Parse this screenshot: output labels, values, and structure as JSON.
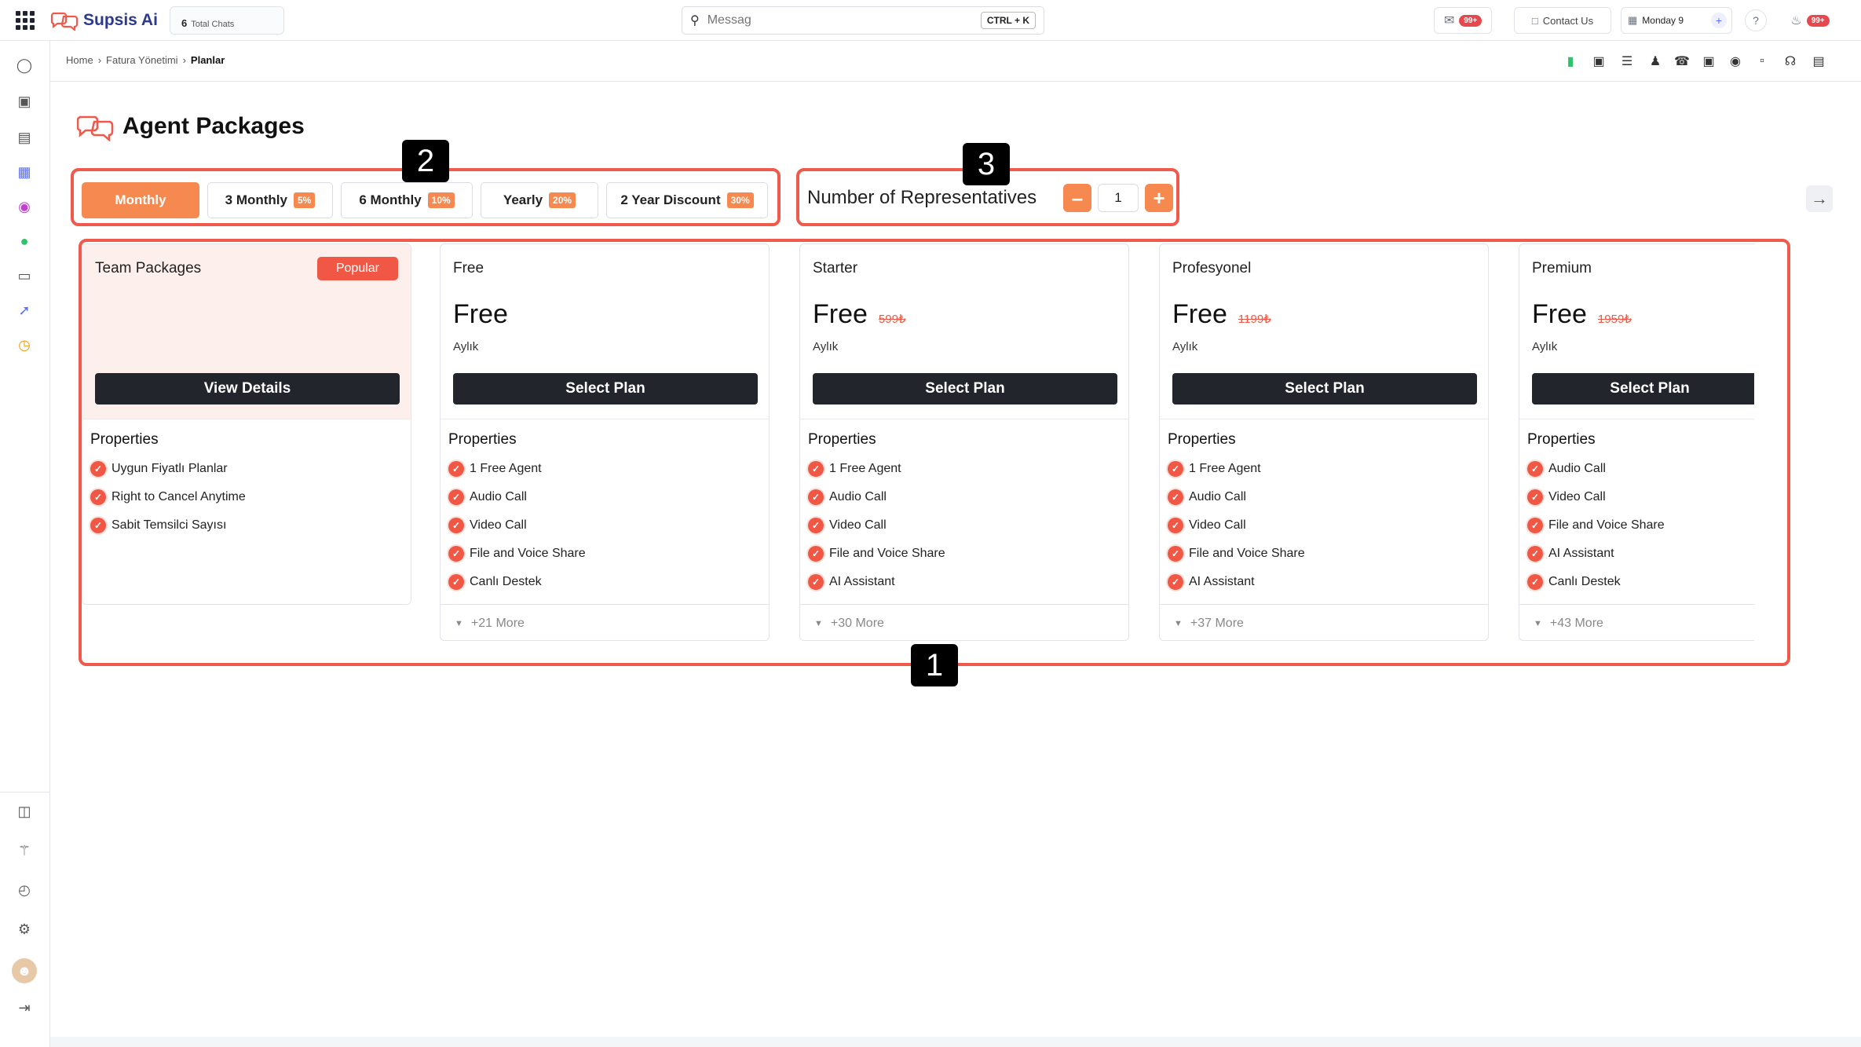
{
  "topbar": {
    "logo": "Supsis Ai",
    "total_chats_count": "6",
    "total_chats_label": "Total Chats",
    "search_placeholder": "Messag",
    "search_shortcut": "CTRL + K",
    "mail_badge": "99+",
    "contact_label": "Contact Us",
    "calendar_label": "Monday 9",
    "notif_badge": "99+"
  },
  "breadcrumb": {
    "home": "Home",
    "billing": "Fatura Yönetimi",
    "current": "Planlar"
  },
  "page": {
    "title": "Agent Packages"
  },
  "tabs": [
    {
      "label": "Monthly",
      "discount": ""
    },
    {
      "label": "3 Monthly",
      "discount": "5%"
    },
    {
      "label": "6 Monthly",
      "discount": "10%"
    },
    {
      "label": "Yearly",
      "discount": "20%"
    },
    {
      "label": "2 Year Discount",
      "discount": "30%"
    }
  ],
  "representatives": {
    "label": "Number of Representatives",
    "value": "1"
  },
  "markers": [
    "1",
    "2",
    "3"
  ],
  "cards": [
    {
      "name": "Team Packages",
      "badge": "Popular",
      "button": "View Details",
      "properties_label": "Properties",
      "features": [
        "Uygun Fiyatlı Planlar",
        "Right to Cancel Anytime",
        "Sabit Temsilci Sayısı"
      ]
    },
    {
      "name": "Free",
      "price": "Free",
      "old_price": "",
      "period": "Aylık",
      "button": "Select Plan",
      "properties_label": "Properties",
      "features": [
        "1 Free Agent",
        "Audio Call",
        "Video Call",
        "File and Voice Share",
        "Canlı Destek"
      ],
      "more": "+21 More"
    },
    {
      "name": "Starter",
      "price": "Free",
      "old_price": "599₺",
      "period": "Aylık",
      "button": "Select Plan",
      "properties_label": "Properties",
      "features": [
        "1 Free Agent",
        "Audio Call",
        "Video Call",
        "File and Voice Share",
        "AI Assistant"
      ],
      "more": "+30 More"
    },
    {
      "name": "Profesyonel",
      "price": "Free",
      "old_price": "1199₺",
      "period": "Aylık",
      "button": "Select Plan",
      "properties_label": "Properties",
      "features": [
        "1 Free Agent",
        "Audio Call",
        "Video Call",
        "File and Voice Share",
        "AI Assistant"
      ],
      "more": "+37 More"
    },
    {
      "name": "Premium",
      "price": "Free",
      "old_price": "1959₺",
      "period": "Aylık",
      "button": "Select Plan",
      "properties_label": "Properties",
      "features": [
        "Audio Call",
        "Video Call",
        "File and Voice Share",
        "AI Assistant",
        "Canlı Destek"
      ],
      "more": "+43 More"
    }
  ],
  "colors": {
    "accent": "#f6894f",
    "highlight_box": "#ef5a4c",
    "check": "#f05744",
    "button_dark": "#22252b"
  }
}
